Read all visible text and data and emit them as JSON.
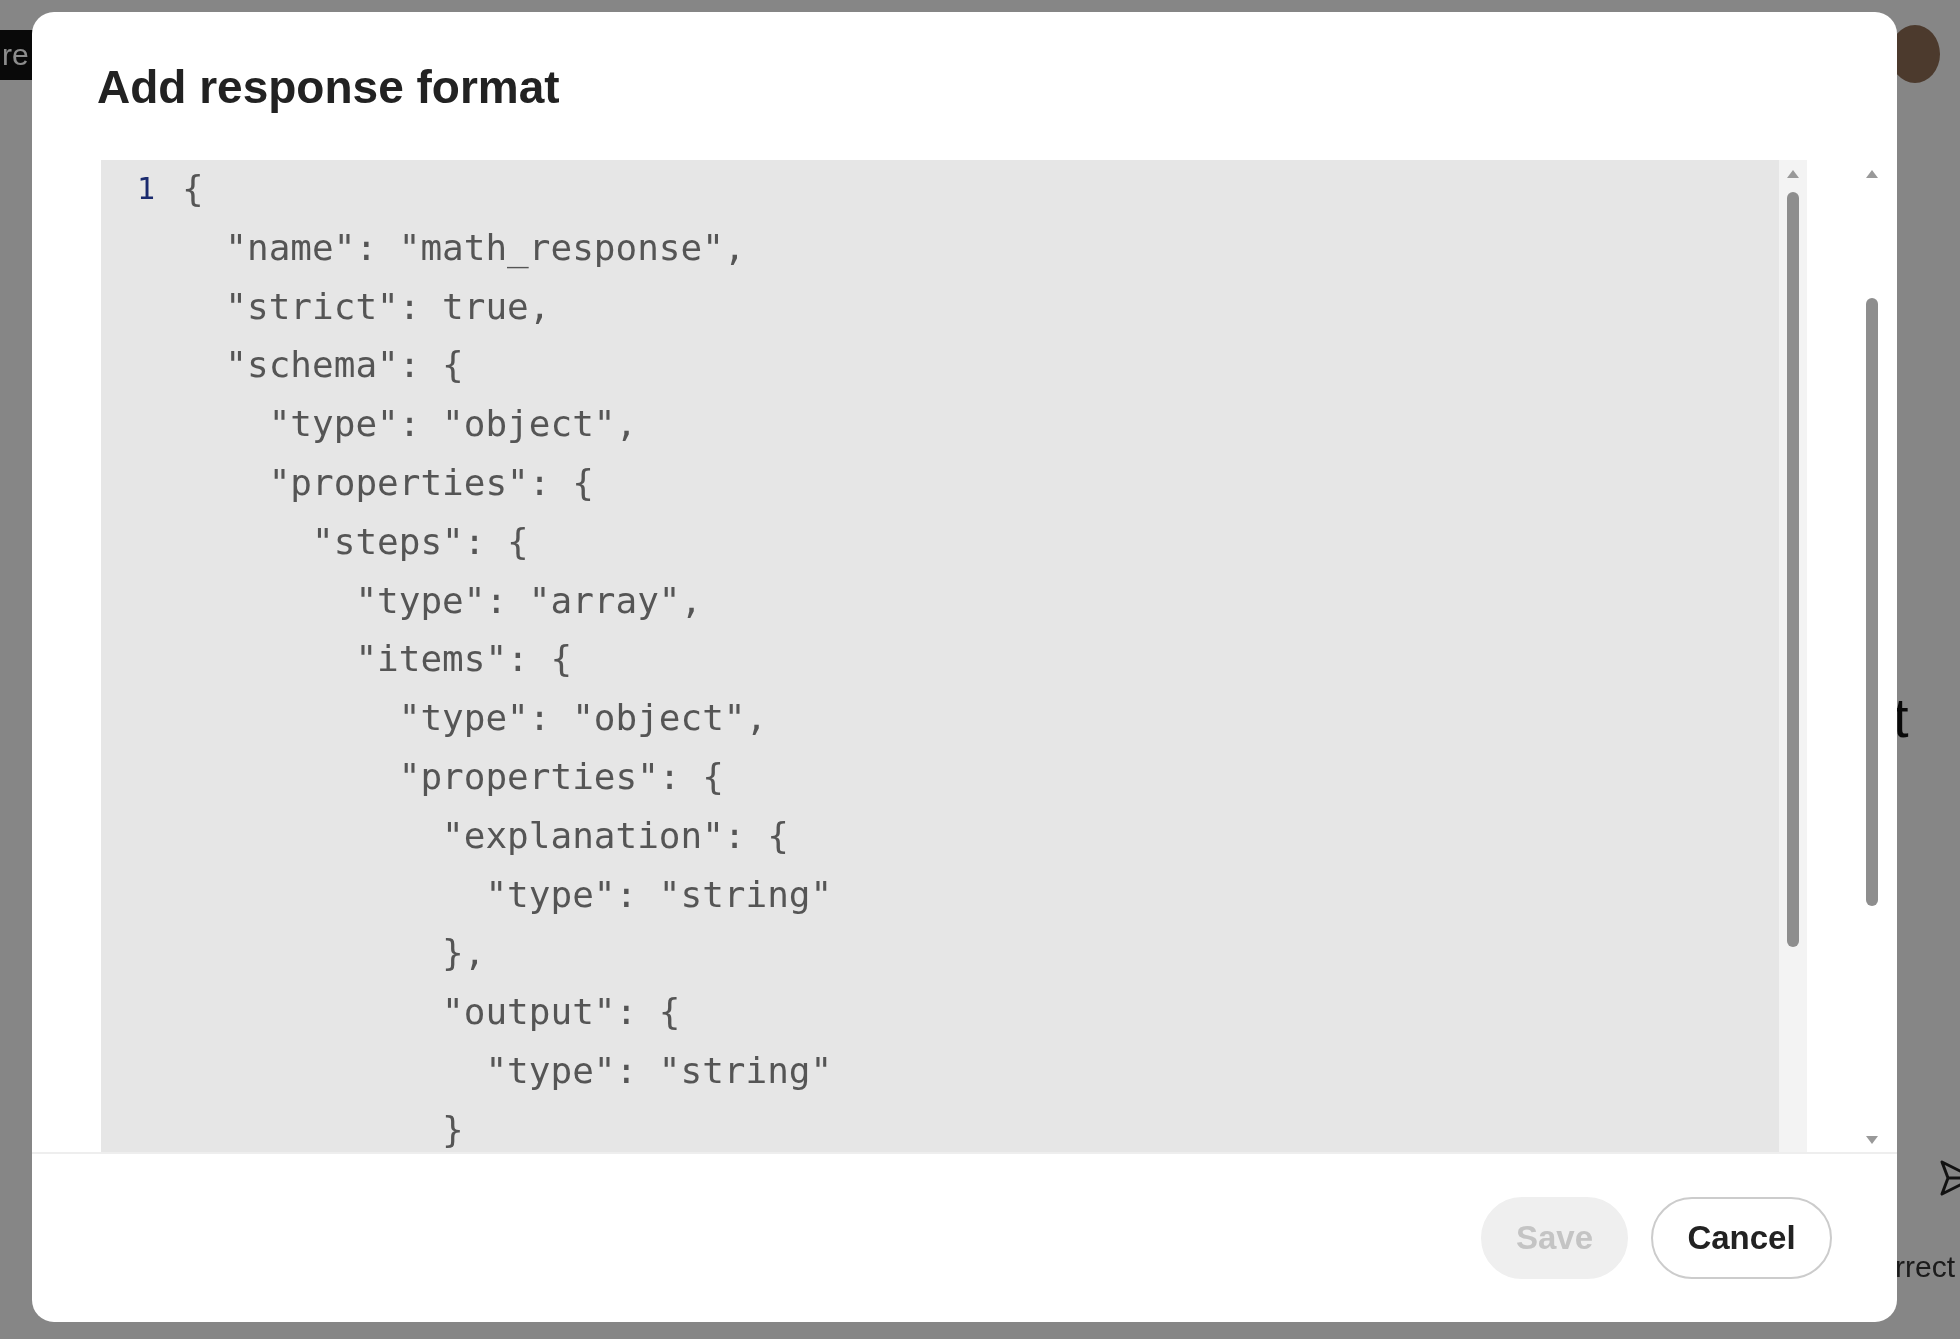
{
  "background": {
    "tag": "re",
    "heading_fragment": "t",
    "text_fragment": "rrect"
  },
  "dialog": {
    "title": "Add response format",
    "editor": {
      "line_number": "1",
      "lines": [
        "{",
        "  \"name\": \"math_response\",",
        "  \"strict\": true,",
        "  \"schema\": {",
        "    \"type\": \"object\",",
        "    \"properties\": {",
        "      \"steps\": {",
        "        \"type\": \"array\",",
        "        \"items\": {",
        "          \"type\": \"object\",",
        "          \"properties\": {",
        "            \"explanation\": {",
        "              \"type\": \"string\"",
        "            },",
        "            \"output\": {",
        "              \"type\": \"string\"",
        "            }"
      ]
    },
    "buttons": [
      {
        "label": "Save",
        "kind": "primary",
        "disabled": true
      },
      {
        "label": "Cancel",
        "kind": "secondary",
        "disabled": false
      }
    ]
  }
}
